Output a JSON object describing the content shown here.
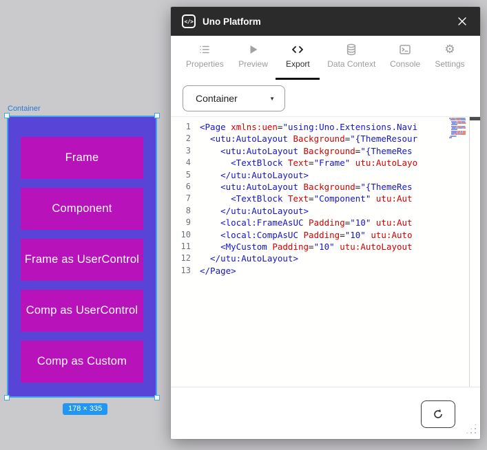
{
  "colors": {
    "container_fill": "#5845d8",
    "button_fill": "#b812ba",
    "selection_blue": "#41a4f0",
    "badge_blue": "#2196f3",
    "titlebar": "#2b2b2b",
    "code_tag_blue": "#1414cc",
    "code_attr_red": "#d40000"
  },
  "canvas": {
    "selection_label": "Container",
    "size_badge": "178 × 335",
    "buttons": [
      "Frame",
      "Component",
      "Frame as UserControl",
      "Comp as UserControl",
      "Comp as Custom"
    ]
  },
  "window": {
    "title": "Uno Platform",
    "logo_glyph": "</>"
  },
  "tabs": [
    {
      "id": "properties",
      "label": "Properties",
      "active": false
    },
    {
      "id": "preview",
      "label": "Preview",
      "active": false
    },
    {
      "id": "export",
      "label": "Export",
      "active": true
    },
    {
      "id": "data-context",
      "label": "Data Context",
      "active": false
    },
    {
      "id": "console",
      "label": "Console",
      "active": false
    },
    {
      "id": "settings",
      "label": "Settings",
      "active": false
    }
  ],
  "export_panel": {
    "selector_value": "Container",
    "caret": "▼"
  },
  "code": {
    "lines": [
      {
        "n": 1,
        "ind": 0,
        "tokens": [
          [
            "b",
            "<Page"
          ],
          [
            "k",
            " "
          ],
          [
            "r",
            "xmlns:uen"
          ],
          [
            "k",
            "="
          ],
          [
            "b",
            "\"using:Uno.Extensions.Navi"
          ]
        ]
      },
      {
        "n": 2,
        "ind": 1,
        "tokens": [
          [
            "b",
            "<utu:AutoLayout"
          ],
          [
            "k",
            " "
          ],
          [
            "r",
            "Background"
          ],
          [
            "k",
            "="
          ],
          [
            "b",
            "\"{ThemeResour"
          ]
        ]
      },
      {
        "n": 3,
        "ind": 2,
        "tokens": [
          [
            "b",
            "<utu:AutoLayout"
          ],
          [
            "k",
            " "
          ],
          [
            "r",
            "Background"
          ],
          [
            "k",
            "="
          ],
          [
            "b",
            "\"{ThemeRes"
          ]
        ]
      },
      {
        "n": 4,
        "ind": 3,
        "tokens": [
          [
            "b",
            "<TextBlock"
          ],
          [
            "k",
            " "
          ],
          [
            "r",
            "Text"
          ],
          [
            "k",
            "="
          ],
          [
            "b",
            "\"Frame\""
          ],
          [
            "k",
            " "
          ],
          [
            "r",
            "utu:AutoLayo"
          ]
        ]
      },
      {
        "n": 5,
        "ind": 2,
        "tokens": [
          [
            "b",
            "</utu:AutoLayout>"
          ]
        ]
      },
      {
        "n": 6,
        "ind": 2,
        "tokens": [
          [
            "b",
            "<utu:AutoLayout"
          ],
          [
            "k",
            " "
          ],
          [
            "r",
            "Background"
          ],
          [
            "k",
            "="
          ],
          [
            "b",
            "\"{ThemeRes"
          ]
        ]
      },
      {
        "n": 7,
        "ind": 3,
        "tokens": [
          [
            "b",
            "<TextBlock"
          ],
          [
            "k",
            " "
          ],
          [
            "r",
            "Text"
          ],
          [
            "k",
            "="
          ],
          [
            "b",
            "\"Component\""
          ],
          [
            "k",
            " "
          ],
          [
            "r",
            "utu:Aut"
          ]
        ]
      },
      {
        "n": 8,
        "ind": 2,
        "tokens": [
          [
            "b",
            "</utu:AutoLayout>"
          ]
        ]
      },
      {
        "n": 9,
        "ind": 2,
        "tokens": [
          [
            "b",
            "<local:FrameAsUC"
          ],
          [
            "k",
            " "
          ],
          [
            "r",
            "Padding"
          ],
          [
            "k",
            "="
          ],
          [
            "b",
            "\"10\""
          ],
          [
            "k",
            " "
          ],
          [
            "r",
            "utu:Aut"
          ]
        ]
      },
      {
        "n": 10,
        "ind": 2,
        "tokens": [
          [
            "b",
            "<local:CompAsUC"
          ],
          [
            "k",
            " "
          ],
          [
            "r",
            "Padding"
          ],
          [
            "k",
            "="
          ],
          [
            "b",
            "\"10\""
          ],
          [
            "k",
            " "
          ],
          [
            "r",
            "utu:Auto"
          ]
        ]
      },
      {
        "n": 11,
        "ind": 2,
        "tokens": [
          [
            "b",
            "<MyCustom"
          ],
          [
            "k",
            " "
          ],
          [
            "r",
            "Padding"
          ],
          [
            "k",
            "="
          ],
          [
            "b",
            "\"10\""
          ],
          [
            "k",
            " "
          ],
          [
            "r",
            "utu:AutoLayout"
          ]
        ]
      },
      {
        "n": 12,
        "ind": 1,
        "tokens": [
          [
            "b",
            "</utu:AutoLayout>"
          ]
        ]
      },
      {
        "n": 13,
        "ind": 0,
        "tokens": [
          [
            "b",
            "</Page>"
          ]
        ]
      }
    ]
  }
}
